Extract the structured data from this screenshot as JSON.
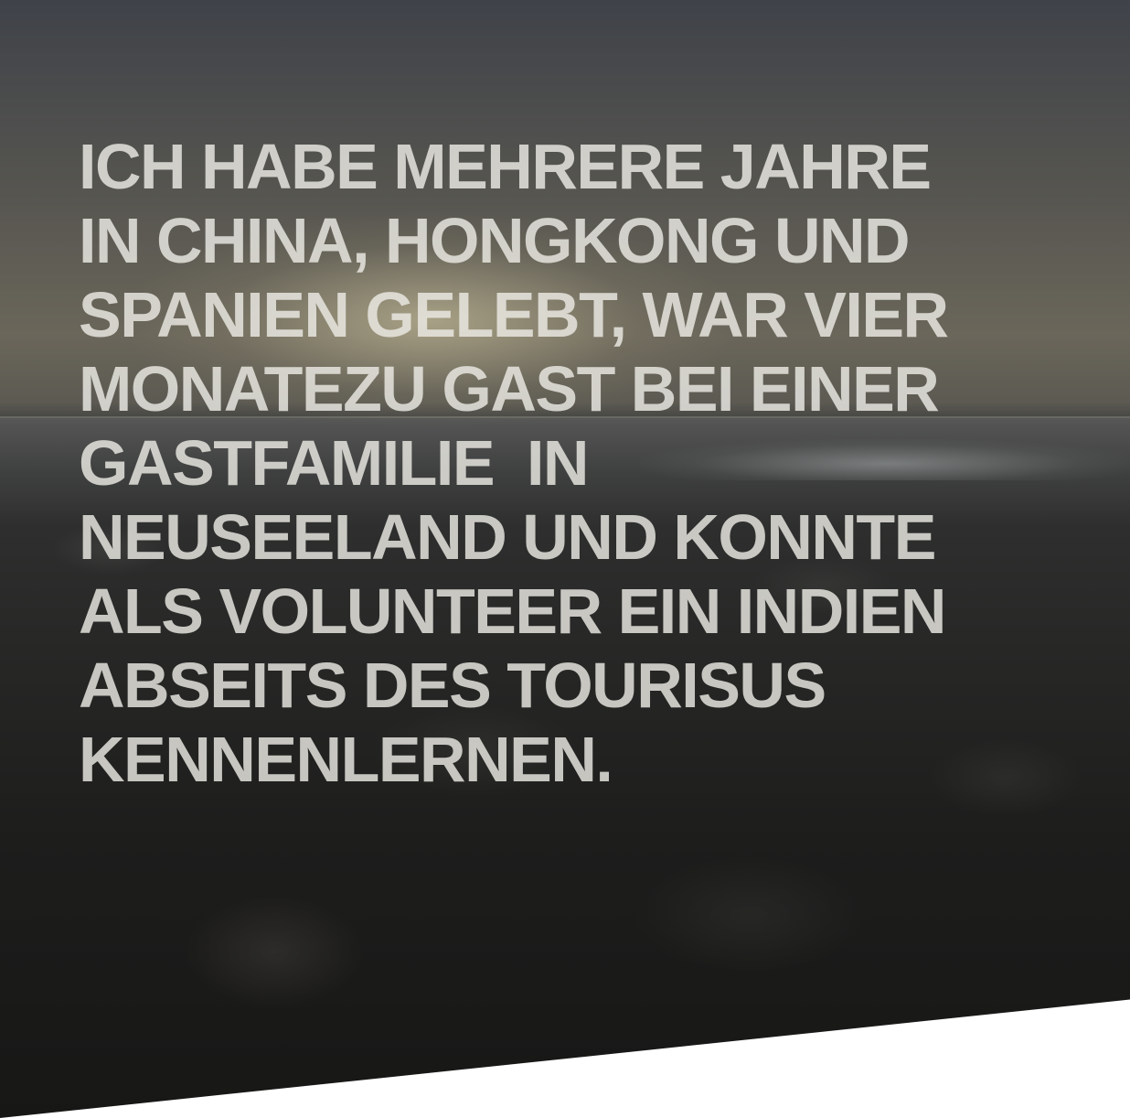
{
  "headline": {
    "lines": [
      "ICH HABE MEHRERE JAHRE",
      "IN CHINA, HONGKONG UND",
      "SPANIEN GELEBT, WAR VIER",
      "MONATEZU GAST BEI EINER",
      "GASTFAMILIE  IN",
      "NEUSEELAND UND KONNTE",
      "ALS VOLUNTEER EIN INDIEN",
      "ABSEITS DES TOURISUS",
      "KENNENLERNEN."
    ]
  },
  "colors": {
    "text": "#ECEAE4",
    "background_below": "#FFFFFF"
  }
}
